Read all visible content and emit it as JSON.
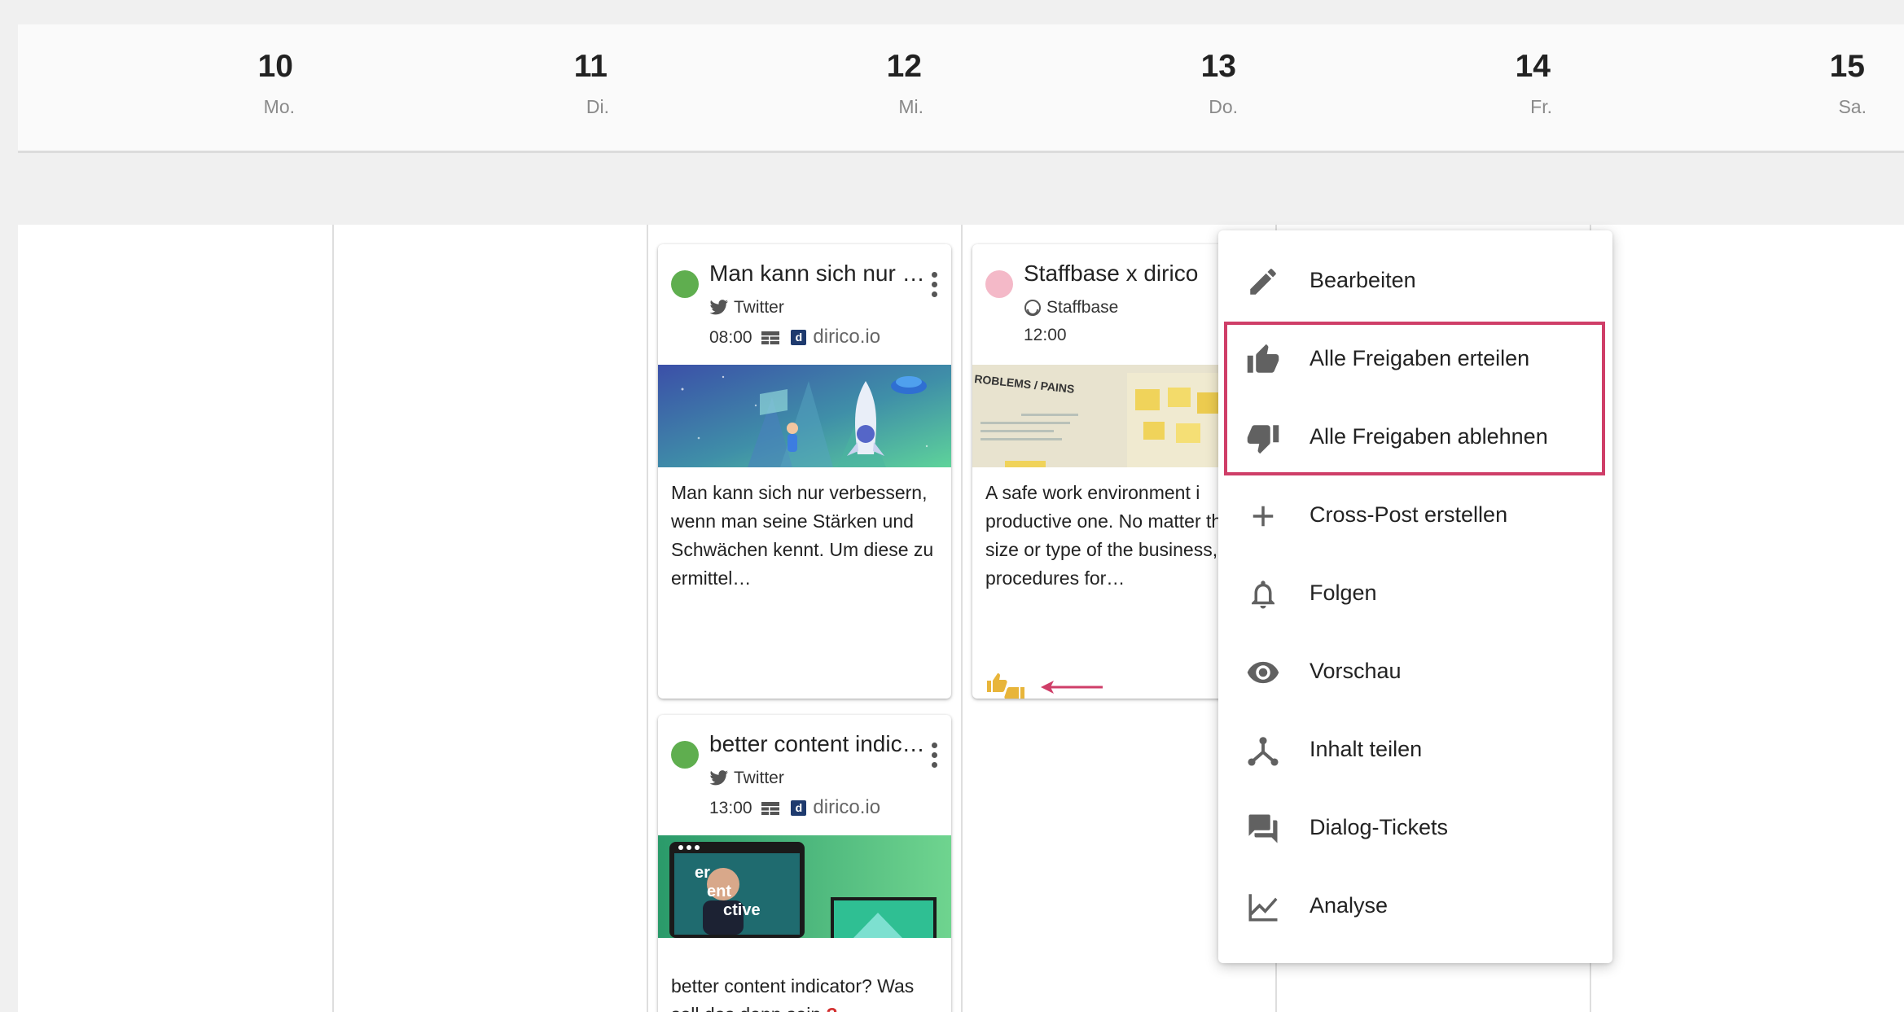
{
  "days": [
    {
      "num": "10",
      "weekday": "Mo."
    },
    {
      "num": "11",
      "weekday": "Di."
    },
    {
      "num": "12",
      "weekday": "Mi."
    },
    {
      "num": "13",
      "weekday": "Do."
    },
    {
      "num": "14",
      "weekday": "Fr."
    },
    {
      "num": "15",
      "weekday": "Sa."
    }
  ],
  "posts": [
    {
      "title": "Man kann sich nur v…",
      "network": "Twitter",
      "time": "08:00",
      "brand": "dirico.io",
      "brand_badge": "d",
      "status_color": "#5fae4f",
      "text": "Man kann sich nur verbessern, wenn man seine Stärken und Schwächen kennt. Um diese zu ermittel…"
    },
    {
      "title": "Staffbase x dirico",
      "network": "Staffbase",
      "time": "12:00",
      "status_color": "#f4b9c8",
      "text": "A safe work environment i productive one. No matter the size or type of the business, procedures for…",
      "image_caption": "ROBLEMS / PAINS"
    },
    {
      "title": "better content indic…",
      "network": "Twitter",
      "time": "13:00",
      "brand": "dirico.io",
      "brand_badge": "d",
      "status_color": "#5fae4f",
      "text_line1": "better content indicator? Was",
      "text_line2": "soll das denn sein",
      "text_mark": "?",
      "image_caption_1": "er",
      "image_caption_2": "ent",
      "image_caption_3": "ctive"
    }
  ],
  "menu": {
    "items": [
      {
        "label": "Bearbeiten",
        "icon": "pencil-icon"
      },
      {
        "label": "Alle Freigaben erteilen",
        "icon": "thumb-up-icon"
      },
      {
        "label": "Alle Freigaben ablehnen",
        "icon": "thumb-down-icon"
      },
      {
        "label": "Cross-Post erstellen",
        "icon": "plus-icon"
      },
      {
        "label": "Folgen",
        "icon": "bell-icon"
      },
      {
        "label": "Vorschau",
        "icon": "eye-icon"
      },
      {
        "label": "Inhalt teilen",
        "icon": "share-icon"
      },
      {
        "label": "Dialog-Tickets",
        "icon": "chat-icon"
      },
      {
        "label": "Analyse",
        "icon": "chart-icon"
      }
    ]
  },
  "colors": {
    "highlight": "#cf3e68",
    "approval_icon": "#e8b53a",
    "twitter_icon": "#555555"
  }
}
